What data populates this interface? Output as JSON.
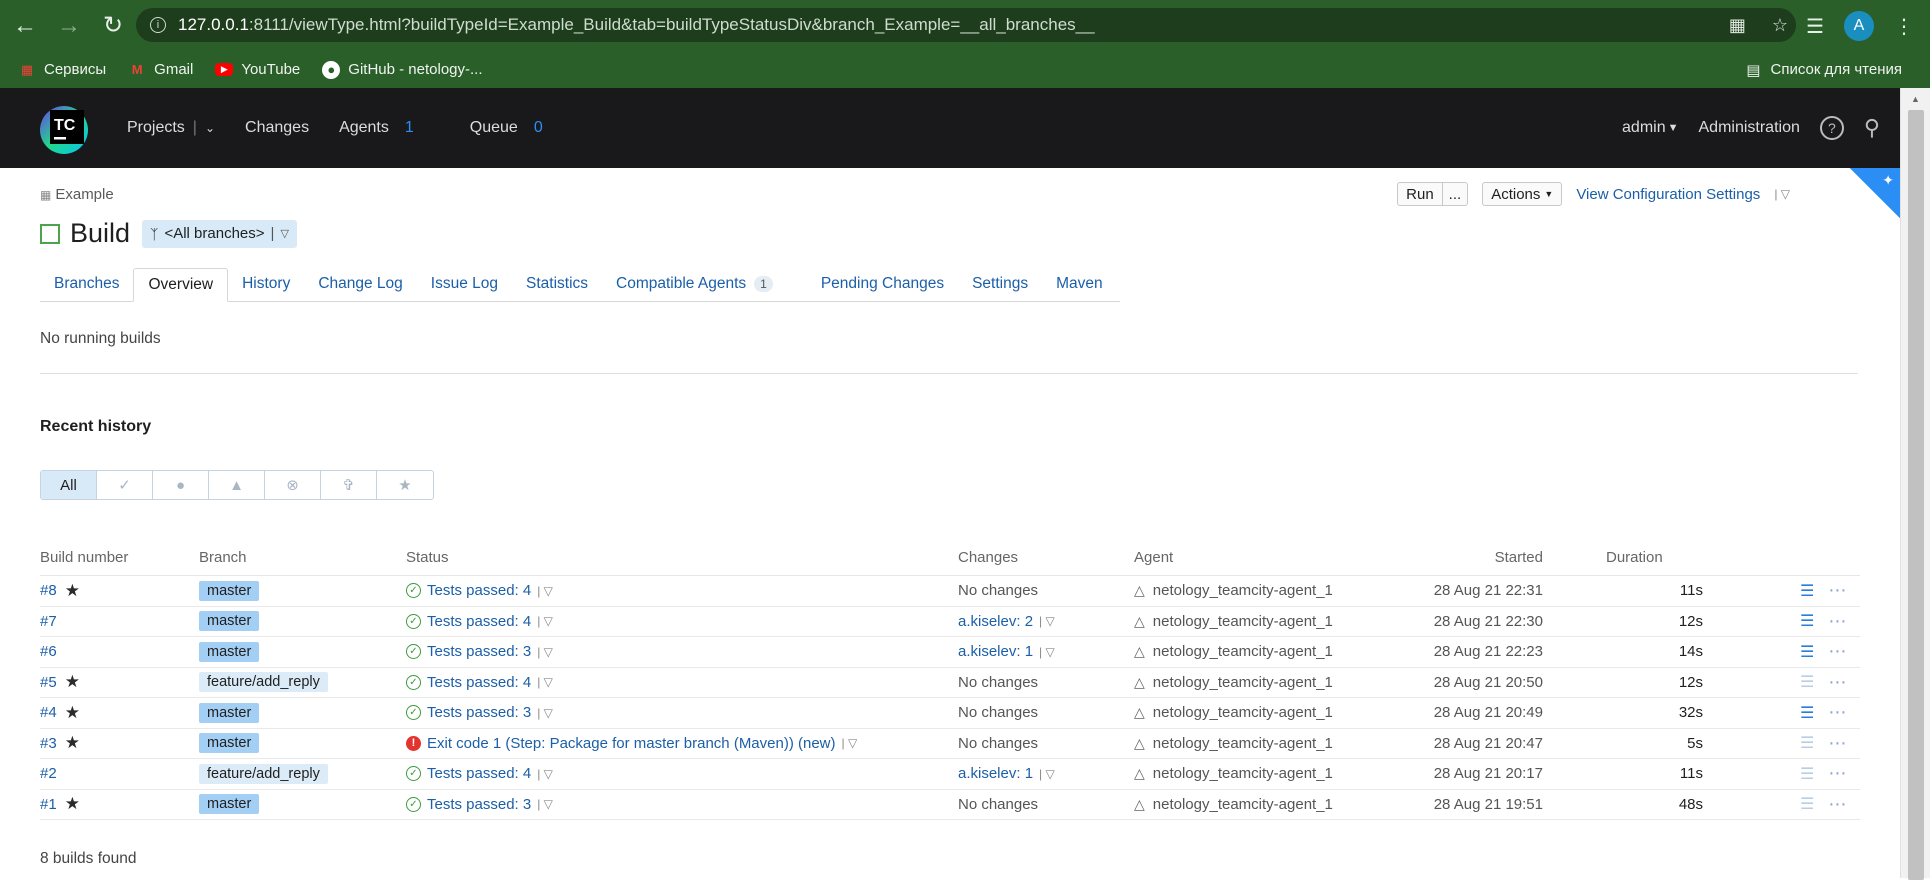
{
  "browser": {
    "url_host": "127.0.0.1",
    "url_rest": ":8111/viewType.html?buildTypeId=Example_Build&tab=buildTypeStatusDiv&branch_Example=__all_branches__",
    "avatar_letter": "A",
    "bookmarks": [
      {
        "label": "Сервисы",
        "icon": "apps-grid-icon"
      },
      {
        "label": "Gmail",
        "icon": "gmail-icon"
      },
      {
        "label": "YouTube",
        "icon": "youtube-icon"
      },
      {
        "label": "GitHub - netology-...",
        "icon": "github-icon"
      }
    ],
    "reading_list": "Список для чтения"
  },
  "tc": {
    "logo_text": "TC",
    "nav": {
      "projects": "Projects",
      "changes": "Changes",
      "agents": "Agents",
      "agents_count": "1",
      "queue": "Queue",
      "queue_count": "0"
    },
    "user": "admin",
    "administration": "Administration"
  },
  "page": {
    "breadcrumb": "Example",
    "title": "Build",
    "branch_selector": "<All branches>",
    "run_button": "Run",
    "run_more": "...",
    "actions_button": "Actions",
    "view_config": "View Configuration Settings",
    "tabs": [
      {
        "label": "Branches"
      },
      {
        "label": "Overview",
        "active": true
      },
      {
        "label": "History"
      },
      {
        "label": "Change Log"
      },
      {
        "label": "Issue Log"
      },
      {
        "label": "Statistics"
      },
      {
        "label": "Compatible Agents",
        "count": "1"
      },
      {
        "label": "Pending Changes"
      },
      {
        "label": "Settings"
      },
      {
        "label": "Maven"
      }
    ],
    "no_running": "No running builds",
    "recent_history": "Recent history",
    "filters": [
      {
        "label": "All",
        "icon": "",
        "active": true
      },
      {
        "label": "",
        "icon": "success-filter-icon"
      },
      {
        "label": "",
        "icon": "failed-filter-icon"
      },
      {
        "label": "",
        "icon": "warning-filter-icon"
      },
      {
        "label": "",
        "icon": "cancelled-filter-icon"
      },
      {
        "label": "",
        "icon": "pin-filter-icon"
      },
      {
        "label": "",
        "icon": "star-filter-icon"
      }
    ],
    "builds_found": "8 builds found"
  },
  "table": {
    "headers": {
      "number": "Build number",
      "branch": "Branch",
      "status": "Status",
      "changes": "Changes",
      "agent": "Agent",
      "started": "Started",
      "duration": "Duration"
    },
    "rows": [
      {
        "number": "#8",
        "starred": true,
        "branch": "master",
        "branch_style": "dark",
        "status": "Tests passed: 4",
        "status_type": "ok",
        "changes": "No changes",
        "changes_link": false,
        "agent": "netology_teamcity-agent_1",
        "started": "28 Aug 21 22:31",
        "duration": "11s",
        "artifacts": true
      },
      {
        "number": "#7",
        "starred": false,
        "branch": "master",
        "branch_style": "dark",
        "status": "Tests passed: 4",
        "status_type": "ok",
        "changes": "a.kiselev: 2",
        "changes_link": true,
        "agent": "netology_teamcity-agent_1",
        "started": "28 Aug 21 22:30",
        "duration": "12s",
        "artifacts": true
      },
      {
        "number": "#6",
        "starred": false,
        "branch": "master",
        "branch_style": "dark",
        "status": "Tests passed: 3",
        "status_type": "ok",
        "changes": "a.kiselev: 1",
        "changes_link": true,
        "agent": "netology_teamcity-agent_1",
        "started": "28 Aug 21 22:23",
        "duration": "14s",
        "artifacts": true
      },
      {
        "number": "#5",
        "starred": true,
        "branch": "feature/add_reply",
        "branch_style": "light",
        "status": "Tests passed: 4",
        "status_type": "ok",
        "changes": "No changes",
        "changes_link": false,
        "agent": "netology_teamcity-agent_1",
        "started": "28 Aug 21 20:50",
        "duration": "12s",
        "artifacts": false
      },
      {
        "number": "#4",
        "starred": true,
        "branch": "master",
        "branch_style": "dark",
        "status": "Tests passed: 3",
        "status_type": "ok",
        "changes": "No changes",
        "changes_link": false,
        "agent": "netology_teamcity-agent_1",
        "started": "28 Aug 21 20:49",
        "duration": "32s",
        "artifacts": true
      },
      {
        "number": "#3",
        "starred": true,
        "branch": "master",
        "branch_style": "dark",
        "status": "Exit code 1 (Step: Package for master branch (Maven)) (new)",
        "status_type": "error",
        "changes": "No changes",
        "changes_link": false,
        "agent": "netology_teamcity-agent_1",
        "started": "28 Aug 21 20:47",
        "duration": "5s",
        "artifacts": false
      },
      {
        "number": "#2",
        "starred": false,
        "branch": "feature/add_reply",
        "branch_style": "light",
        "status": "Tests passed: 4",
        "status_type": "ok",
        "changes": "a.kiselev: 1",
        "changes_link": true,
        "agent": "netology_teamcity-agent_1",
        "started": "28 Aug 21 20:17",
        "duration": "11s",
        "artifacts": false
      },
      {
        "number": "#1",
        "starred": true,
        "branch": "master",
        "branch_style": "dark",
        "status": "Tests passed: 3",
        "status_type": "ok",
        "changes": "No changes",
        "changes_link": false,
        "agent": "netology_teamcity-agent_1",
        "started": "28 Aug 21 19:51",
        "duration": "48s",
        "artifacts": false
      }
    ]
  }
}
